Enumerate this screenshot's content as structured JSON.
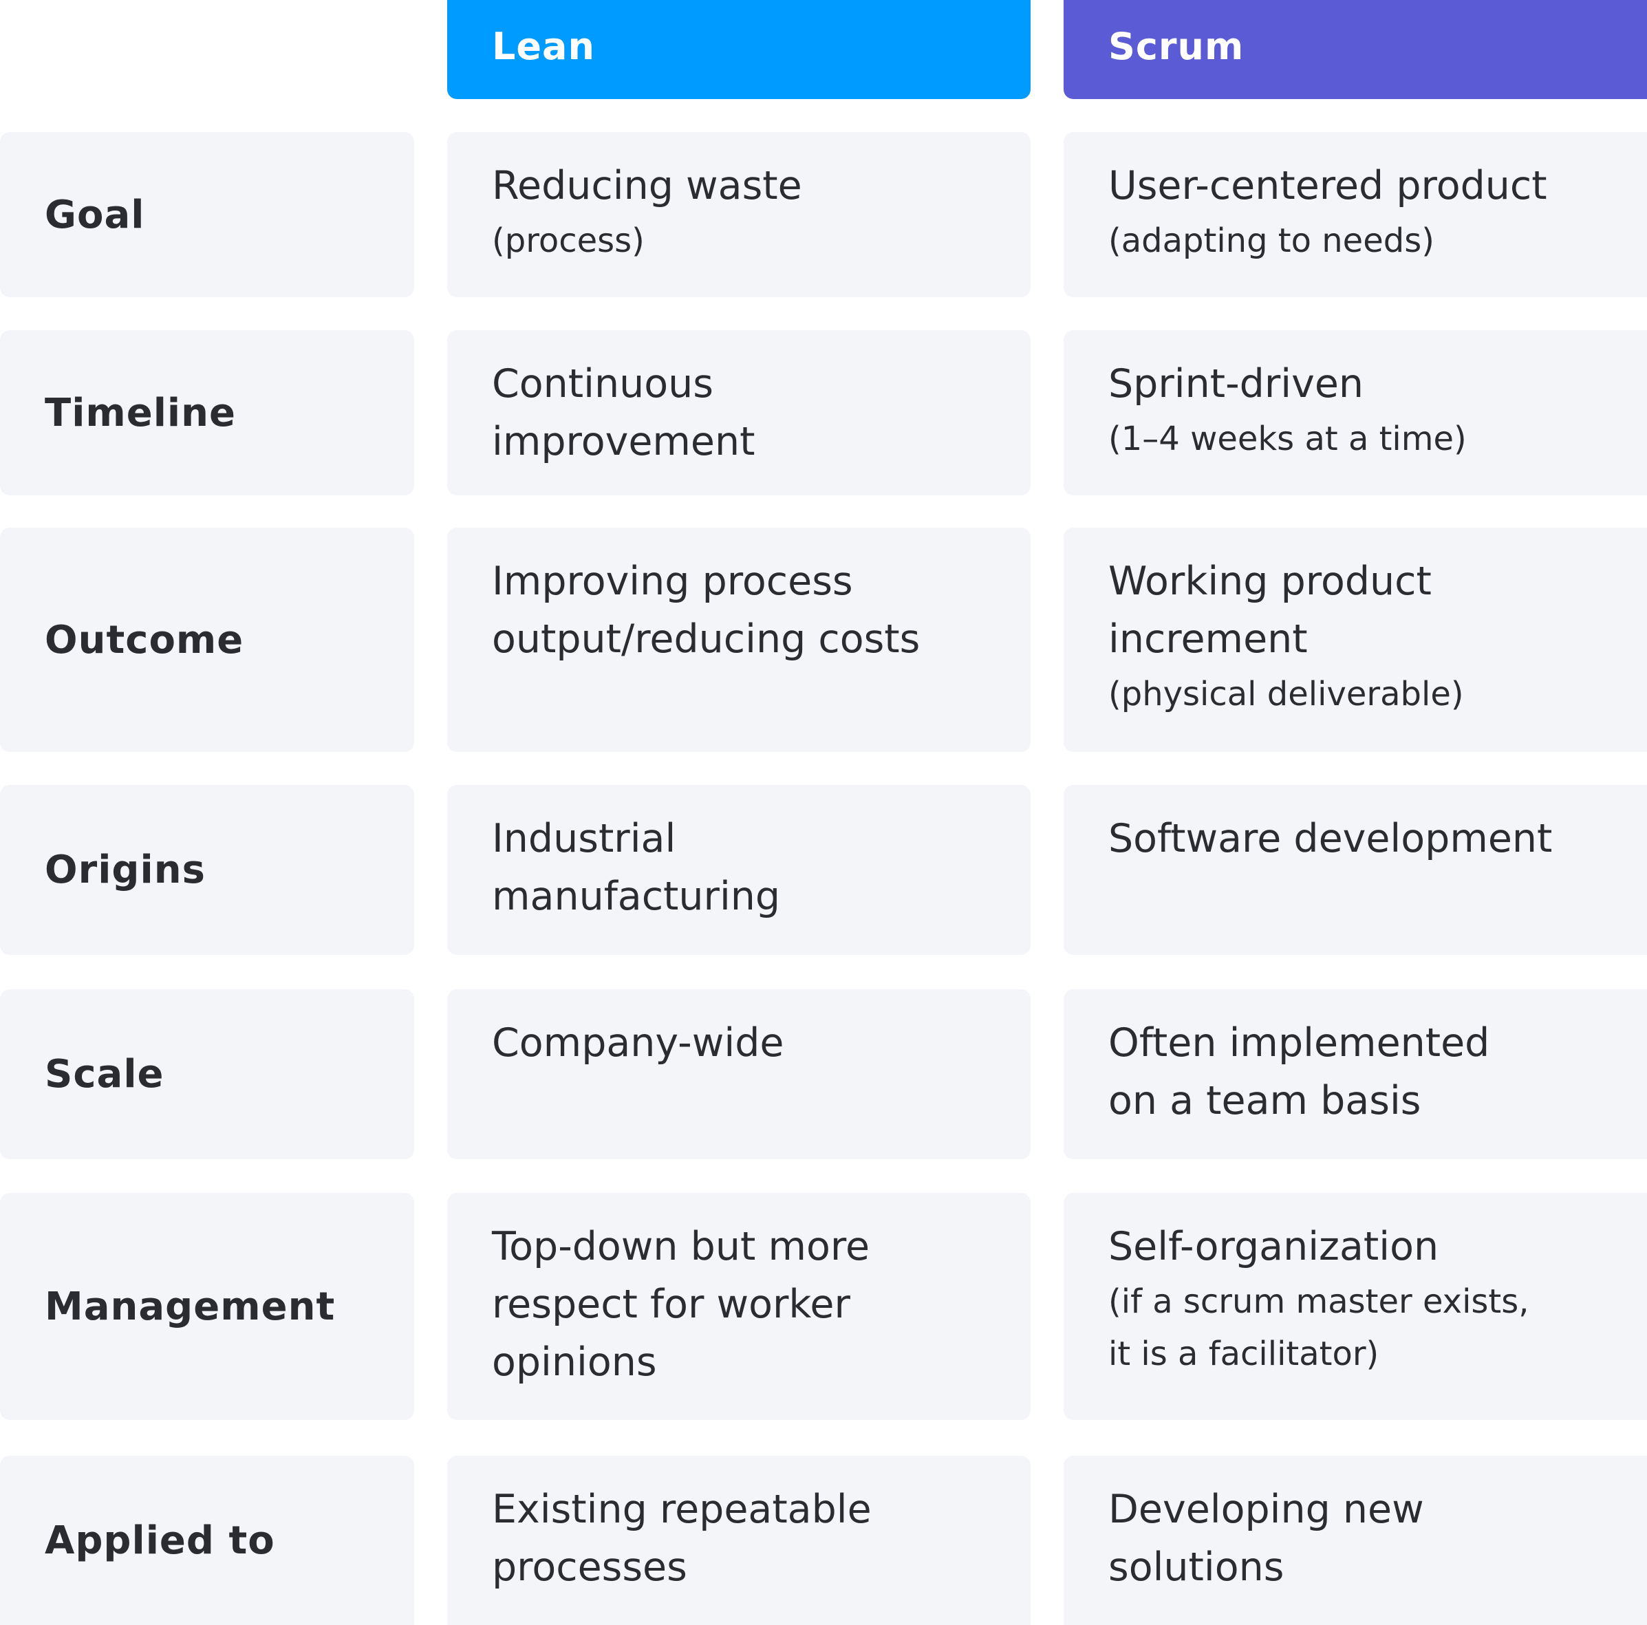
{
  "headers": {
    "lean": "Lean",
    "scrum": "Scrum"
  },
  "colors": {
    "lean": "#009bff",
    "scrum": "#5b5bd6",
    "card_bg": "#f4f5f9",
    "text": "#2b2c31"
  },
  "rows": [
    {
      "label": "Goal",
      "lean": {
        "main": "Reducing waste",
        "sub": "(process)"
      },
      "scrum": {
        "main": "User-centered product",
        "sub": "(adapting to needs)"
      }
    },
    {
      "label": "Timeline",
      "lean": {
        "main": "Continuous\nimprovement",
        "sub": ""
      },
      "scrum": {
        "main": "Sprint-driven",
        "sub": "(1–4 weeks at a time)"
      }
    },
    {
      "label": "Outcome",
      "lean": {
        "main": "Improving process\noutput/reducing costs",
        "sub": ""
      },
      "scrum": {
        "main": "Working product\nincrement",
        "sub": "(physical deliverable)"
      }
    },
    {
      "label": "Origins",
      "lean": {
        "main": "Industrial\nmanufacturing",
        "sub": ""
      },
      "scrum": {
        "main": "Software development",
        "sub": ""
      }
    },
    {
      "label": "Scale",
      "lean": {
        "main": "Company-wide",
        "sub": ""
      },
      "scrum": {
        "main": "Often implemented\non a team basis",
        "sub": ""
      }
    },
    {
      "label": "Management",
      "lean": {
        "main": "Top-down but more\nrespect for worker\nopinions",
        "sub": ""
      },
      "scrum": {
        "main": "Self-organization",
        "sub": "(if a scrum master exists,\nit is a facilitator)"
      }
    },
    {
      "label": "Applied to",
      "lean": {
        "main": "Existing repeatable\nprocesses",
        "sub": ""
      },
      "scrum": {
        "main": "Developing new\nsolutions",
        "sub": ""
      }
    }
  ]
}
